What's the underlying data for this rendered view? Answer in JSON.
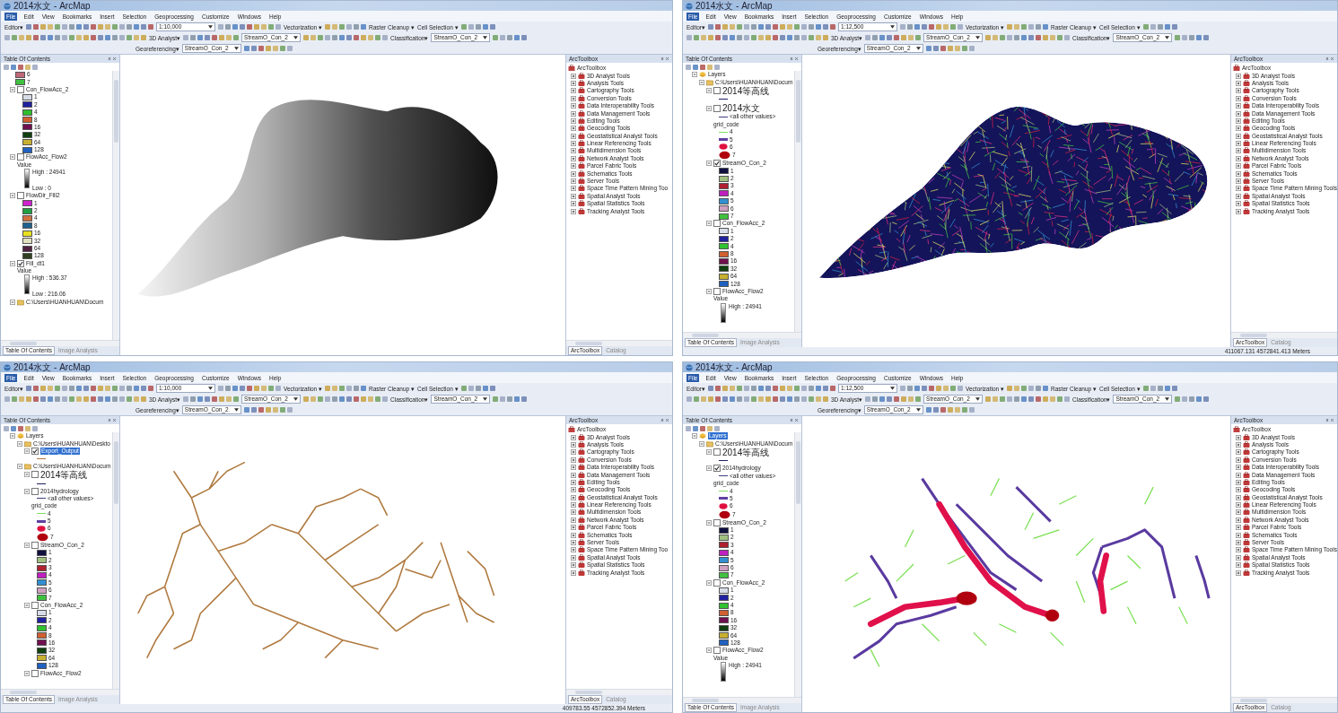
{
  "panels": [
    {
      "title": "2014水文 - ArcMap",
      "menu": [
        {
          "label": "File",
          "selected": true
        },
        {
          "label": "Edit",
          "selected": false
        },
        {
          "label": "View",
          "selected": false
        },
        {
          "label": "Bookmarks",
          "selected": false
        },
        {
          "label": "Insert",
          "selected": false
        },
        {
          "label": "Selection",
          "selected": false
        },
        {
          "label": "Geoprocessing",
          "selected": false
        },
        {
          "label": "Customize",
          "selected": false
        },
        {
          "label": "Windows",
          "selected": false
        },
        {
          "label": "Help",
          "selected": false
        }
      ],
      "toolbars": [
        [
          {
            "kind": "menu",
            "label": "Editor▾"
          },
          {
            "kind": "dropdown",
            "value": "1:10,000"
          },
          {
            "kind": "menu",
            "label": "Vectorization ▾"
          },
          {
            "kind": "menu",
            "label": "Raster Cleanup ▾"
          },
          {
            "kind": "menu",
            "label": "Cell Selection ▾"
          }
        ],
        [
          {
            "kind": "menu",
            "label": "3D Analyst▾"
          },
          {
            "kind": "dropdown",
            "value": "StreamO_Con_2"
          },
          {
            "kind": "menu",
            "label": "Classification▾"
          },
          {
            "kind": "dropdown",
            "value": "StreamO_Con_2"
          }
        ],
        [
          {
            "kind": "menu",
            "label": "Georeferencing▾"
          },
          {
            "kind": "dropdown",
            "value": "StreamO_Con_2"
          }
        ]
      ],
      "toc": {
        "title": "Table Of Contents",
        "items": [
          {
            "kind": "swatch",
            "label": "6",
            "color": "#c06878"
          },
          {
            "kind": "swatch",
            "label": "7",
            "color": "#40c040"
          },
          {
            "kind": "layer",
            "label": "Con_FlowAcc_2",
            "checked": false,
            "selected": false,
            "expanded": true,
            "children": [
              {
                "kind": "swatch",
                "label": "1",
                "color": "#d8dce8"
              },
              {
                "kind": "swatch",
                "label": "2",
                "color": "#2020a0"
              },
              {
                "kind": "swatch",
                "label": "4",
                "color": "#30c030"
              },
              {
                "kind": "swatch",
                "label": "8",
                "color": "#d06030"
              },
              {
                "kind": "swatch",
                "label": "16",
                "color": "#701050"
              },
              {
                "kind": "swatch",
                "label": "32",
                "color": "#104010"
              },
              {
                "kind": "swatch",
                "label": "64",
                "color": "#c8b030"
              },
              {
                "kind": "swatch",
                "label": "128",
                "color": "#2060c0"
              }
            ]
          },
          {
            "kind": "layer",
            "label": "FlowAcc_Flow2",
            "checked": false,
            "selected": false,
            "expanded": true,
            "children": [
              {
                "kind": "heading",
                "label": "Value"
              },
              {
                "kind": "ramp",
                "high": "High : 24941",
                "low": "Low : 0"
              }
            ]
          },
          {
            "kind": "layer",
            "label": "FlowDir_Fill2",
            "checked": false,
            "selected": false,
            "expanded": true,
            "children": [
              {
                "kind": "swatch",
                "label": "1",
                "color": "#d020d0"
              },
              {
                "kind": "swatch",
                "label": "2",
                "color": "#20a040"
              },
              {
                "kind": "swatch",
                "label": "4",
                "color": "#d07040"
              },
              {
                "kind": "swatch",
                "label": "8",
                "color": "#206090"
              },
              {
                "kind": "swatch",
                "label": "16",
                "color": "#e8e020"
              },
              {
                "kind": "swatch",
                "label": "32",
                "color": "#e0e0c0"
              },
              {
                "kind": "swatch",
                "label": "64",
                "color": "#502040"
              },
              {
                "kind": "swatch",
                "label": "128",
                "color": "#304020"
              }
            ]
          },
          {
            "kind": "layer",
            "label": "Fill_dt1",
            "checked": true,
            "selected": false,
            "expanded": true,
            "children": [
              {
                "kind": "heading",
                "label": "Value"
              },
              {
                "kind": "ramp",
                "high": "High : 536.37",
                "low": "Low : 216.06"
              }
            ]
          },
          {
            "kind": "group",
            "label": "C:\\Users\\HUANHUAN\\Docum",
            "selected": false,
            "expanded": true
          }
        ]
      },
      "map": {
        "kind": "elevation"
      },
      "toolbox": {
        "title": "ArcToolbox",
        "root": "ArcToolbox",
        "items": [
          "3D Analyst Tools",
          "Analysis Tools",
          "Cartography Tools",
          "Conversion Tools",
          "Data Interoperability Tools",
          "Data Management Tools",
          "Editing Tools",
          "Geocoding Tools",
          "Geostatistical Analyst Tools",
          "Linear Referencing Tools",
          "Multidimension Tools",
          "Network Analyst Tools",
          "Parcel Fabric Tools",
          "Schematics Tools",
          "Server Tools",
          "Space Time Pattern Mining Too",
          "Spatial Analyst Tools",
          "Spatial Statistics Tools",
          "Tracking Analyst Tools"
        ]
      },
      "tabs_left": [
        {
          "label": "Table Of Contents",
          "selected": true
        },
        {
          "label": "Image Analysis",
          "selected": false
        }
      ],
      "tabs_right": [
        {
          "label": "ArcToolbox",
          "selected": true
        },
        {
          "label": "Catalog",
          "selected": false
        }
      ]
    },
    {
      "title": "2014水文 - ArcMap",
      "menu": [
        {
          "label": "File",
          "selected": true
        },
        {
          "label": "Edit",
          "selected": false
        },
        {
          "label": "View",
          "selected": false
        },
        {
          "label": "Bookmarks",
          "selected": false
        },
        {
          "label": "Insert",
          "selected": false
        },
        {
          "label": "Selection",
          "selected": false
        },
        {
          "label": "Geoprocessing",
          "selected": false
        },
        {
          "label": "Customize",
          "selected": false
        },
        {
          "label": "Windows",
          "selected": false
        },
        {
          "label": "Help",
          "selected": false
        }
      ],
      "toolbars": [
        [
          {
            "kind": "menu",
            "label": "Editor▾"
          },
          {
            "kind": "dropdown",
            "value": "1:12,500"
          },
          {
            "kind": "menu",
            "label": "Vectorization ▾"
          },
          {
            "kind": "menu",
            "label": "Raster Cleanup ▾"
          },
          {
            "kind": "menu",
            "label": "Cell Selection ▾"
          }
        ],
        [
          {
            "kind": "menu",
            "label": "3D Analyst▾"
          },
          {
            "kind": "dropdown",
            "value": "StreamO_Con_2"
          },
          {
            "kind": "menu",
            "label": "Classification▾"
          },
          {
            "kind": "dropdown",
            "value": "StreamO_Con_2"
          }
        ],
        [
          {
            "kind": "menu",
            "label": "Georeferencing▾"
          },
          {
            "kind": "dropdown",
            "value": "StreamO_Con_2"
          }
        ]
      ],
      "toc": {
        "title": "Table Of Contents",
        "items": [
          {
            "kind": "root",
            "label": "Layers",
            "selected": false,
            "expanded": true,
            "children": [
              {
                "kind": "group",
                "label": "C:\\Users\\HUANHUAN\\Docum",
                "selected": false,
                "expanded": true,
                "children": [
                  {
                    "kind": "layer",
                    "label": "2014等高线",
                    "checked": false,
                    "selected": false,
                    "expanded": true,
                    "children": [
                      {
                        "kind": "dash",
                        "color": "#202060"
                      }
                    ]
                  },
                  {
                    "kind": "layer",
                    "label": "2014水文",
                    "checked": false,
                    "selected": false,
                    "expanded": true,
                    "children": [
                      {
                        "kind": "line",
                        "label": "<all other values>",
                        "color": "#404080"
                      },
                      {
                        "kind": "heading",
                        "label": "grid_code"
                      },
                      {
                        "kind": "line",
                        "label": "4",
                        "color": "#80e060"
                      },
                      {
                        "kind": "thick-line",
                        "label": "5",
                        "color": "#6040a0"
                      },
                      {
                        "kind": "blob",
                        "label": "6",
                        "color": "#e01040"
                      },
                      {
                        "kind": "big-blob",
                        "label": "7",
                        "color": "#b00010"
                      }
                    ]
                  },
                  {
                    "kind": "layer",
                    "label": "StreamO_Con_2",
                    "checked": true,
                    "selected": false,
                    "expanded": true,
                    "children": [
                      {
                        "kind": "swatch",
                        "label": "1",
                        "color": "#101040"
                      },
                      {
                        "kind": "swatch",
                        "label": "2",
                        "color": "#a0c080"
                      },
                      {
                        "kind": "swatch",
                        "label": "3",
                        "color": "#b02030"
                      },
                      {
                        "kind": "swatch",
                        "label": "4",
                        "color": "#c020c0"
                      },
                      {
                        "kind": "swatch",
                        "label": "5",
                        "color": "#3090d0"
                      },
                      {
                        "kind": "swatch",
                        "label": "6",
                        "color": "#d0a0c0"
                      },
                      {
                        "kind": "swatch",
                        "label": "7",
                        "color": "#40c040"
                      }
                    ]
                  },
                  {
                    "kind": "layer",
                    "label": "Con_FlowAcc_2",
                    "checked": false,
                    "selected": false,
                    "expanded": true,
                    "children": [
                      {
                        "kind": "swatch",
                        "label": "1",
                        "color": "#d8dce8"
                      },
                      {
                        "kind": "swatch",
                        "label": "2",
                        "color": "#2020a0"
                      },
                      {
                        "kind": "swatch",
                        "label": "4",
                        "color": "#30c030"
                      },
                      {
                        "kind": "swatch",
                        "label": "8",
                        "color": "#d06030"
                      },
                      {
                        "kind": "swatch",
                        "label": "16",
                        "color": "#701050"
                      },
                      {
                        "kind": "swatch",
                        "label": "32",
                        "color": "#104010"
                      },
                      {
                        "kind": "swatch",
                        "label": "64",
                        "color": "#c8b030"
                      },
                      {
                        "kind": "swatch",
                        "label": "128",
                        "color": "#2060c0"
                      }
                    ]
                  },
                  {
                    "kind": "layer",
                    "label": "FlowAcc_Flow2",
                    "checked": false,
                    "selected": false,
                    "expanded": true,
                    "children": [
                      {
                        "kind": "heading",
                        "label": "Value"
                      },
                      {
                        "kind": "ramp",
                        "high": "High : 24941"
                      }
                    ]
                  }
                ]
              }
            ]
          }
        ]
      },
      "map": {
        "kind": "stream-order-raster"
      },
      "toolbox": {
        "title": "ArcToolbox",
        "root": "ArcToolbox",
        "items": [
          "3D Analyst Tools",
          "Analysis Tools",
          "Cartography Tools",
          "Conversion Tools",
          "Data Interoperability Tools",
          "Data Management Tools",
          "Editing Tools",
          "Geocoding Tools",
          "Geostatistical Analyst Tools",
          "Linear Referencing Tools",
          "Multidimension Tools",
          "Network Analyst Tools",
          "Parcel Fabric Tools",
          "Schematics Tools",
          "Server Tools",
          "Space Time Pattern Mining Tools",
          "Spatial Analyst Tools",
          "Spatial Statistics Tools",
          "Tracking Analyst Tools"
        ]
      },
      "tabs_left": [
        {
          "label": "Table Of Contents",
          "selected": true
        },
        {
          "label": "Image Analysis",
          "selected": false
        }
      ],
      "tabs_right": [
        {
          "label": "ArcToolbox",
          "selected": true
        },
        {
          "label": "Catalog",
          "selected": false
        }
      ],
      "status": "411067.131  4572841.413 Meters"
    },
    {
      "title": "2014水文 - ArcMap",
      "menu": [
        {
          "label": "File",
          "selected": true
        },
        {
          "label": "Edit",
          "selected": false
        },
        {
          "label": "View",
          "selected": false
        },
        {
          "label": "Bookmarks",
          "selected": false
        },
        {
          "label": "Insert",
          "selected": false
        },
        {
          "label": "Selection",
          "selected": false
        },
        {
          "label": "Geoprocessing",
          "selected": false
        },
        {
          "label": "Customize",
          "selected": false
        },
        {
          "label": "Windows",
          "selected": false
        },
        {
          "label": "Help",
          "selected": false
        }
      ],
      "toolbars": [
        [
          {
            "kind": "menu",
            "label": "Editor▾"
          },
          {
            "kind": "dropdown",
            "value": "1:10,000"
          },
          {
            "kind": "menu",
            "label": "Vectorization ▾"
          },
          {
            "kind": "menu",
            "label": "Raster Cleanup ▾"
          },
          {
            "kind": "menu",
            "label": "Cell Selection ▾"
          }
        ],
        [
          {
            "kind": "menu",
            "label": "3D Analyst▾"
          },
          {
            "kind": "dropdown",
            "value": "StreamO_Con_2"
          },
          {
            "kind": "menu",
            "label": "Classification▾"
          },
          {
            "kind": "dropdown",
            "value": "StreamO_Con_2"
          }
        ],
        [
          {
            "kind": "menu",
            "label": "Georeferencing▾"
          },
          {
            "kind": "dropdown",
            "value": "StreamO_Con_2"
          }
        ]
      ],
      "toc": {
        "title": "Table Of Contents",
        "items": [
          {
            "kind": "root",
            "label": "Layers",
            "selected": false,
            "expanded": true,
            "children": [
              {
                "kind": "group",
                "label": "C:\\Users\\HUANHUAN\\Deskto",
                "selected": false,
                "expanded": true,
                "children": [
                  {
                    "kind": "layer",
                    "label": "Export_Output",
                    "checked": true,
                    "selected": true,
                    "expanded": true,
                    "children": [
                      {
                        "kind": "dash",
                        "color": "#b07a40"
                      }
                    ]
                  }
                ]
              },
              {
                "kind": "group",
                "label": "C:\\Users\\HUANHUAN\\Docum",
                "selected": false,
                "expanded": true,
                "children": [
                  {
                    "kind": "layer",
                    "label": "2014等高线",
                    "checked": false,
                    "selected": false,
                    "expanded": true,
                    "children": [
                      {
                        "kind": "dash",
                        "color": "#202060"
                      }
                    ]
                  },
                  {
                    "kind": "layer",
                    "label": "2014hydrology",
                    "checked": false,
                    "selected": false,
                    "expanded": true,
                    "children": [
                      {
                        "kind": "line",
                        "label": "<all other values>",
                        "color": "#404080"
                      },
                      {
                        "kind": "heading",
                        "label": "grid_code"
                      },
                      {
                        "kind": "line",
                        "label": "4",
                        "color": "#80e060"
                      },
                      {
                        "kind": "thick-line",
                        "label": "5",
                        "color": "#6040a0"
                      },
                      {
                        "kind": "blob",
                        "label": "6",
                        "color": "#e01040"
                      },
                      {
                        "kind": "big-blob",
                        "label": "7",
                        "color": "#b00010"
                      }
                    ]
                  },
                  {
                    "kind": "layer",
                    "label": "StreamO_Con_2",
                    "checked": false,
                    "selected": false,
                    "expanded": true,
                    "children": [
                      {
                        "kind": "swatch",
                        "label": "1",
                        "color": "#101040"
                      },
                      {
                        "kind": "swatch",
                        "label": "2",
                        "color": "#a0c080"
                      },
                      {
                        "kind": "swatch",
                        "label": "3",
                        "color": "#b02030"
                      },
                      {
                        "kind": "swatch",
                        "label": "4",
                        "color": "#c020c0"
                      },
                      {
                        "kind": "swatch",
                        "label": "5",
                        "color": "#3090d0"
                      },
                      {
                        "kind": "swatch",
                        "label": "6",
                        "color": "#d0a0c0"
                      },
                      {
                        "kind": "swatch",
                        "label": "7",
                        "color": "#40c040"
                      }
                    ]
                  },
                  {
                    "kind": "layer",
                    "label": "Con_FlowAcc_2",
                    "checked": false,
                    "selected": false,
                    "expanded": true,
                    "children": [
                      {
                        "kind": "swatch",
                        "label": "1",
                        "color": "#d8dce8"
                      },
                      {
                        "kind": "swatch",
                        "label": "2",
                        "color": "#2020a0"
                      },
                      {
                        "kind": "swatch",
                        "label": "4",
                        "color": "#30c030"
                      },
                      {
                        "kind": "swatch",
                        "label": "8",
                        "color": "#d06030"
                      },
                      {
                        "kind": "swatch",
                        "label": "16",
                        "color": "#701050"
                      },
                      {
                        "kind": "swatch",
                        "label": "32",
                        "color": "#104010"
                      },
                      {
                        "kind": "swatch",
                        "label": "64",
                        "color": "#c8b030"
                      },
                      {
                        "kind": "swatch",
                        "label": "128",
                        "color": "#2060c0"
                      }
                    ]
                  },
                  {
                    "kind": "layer",
                    "label": "FlowAcc_Flow2",
                    "checked": false,
                    "selected": false,
                    "expanded": true
                  }
                ]
              }
            ]
          }
        ]
      },
      "map": {
        "kind": "stream-lines"
      },
      "toolbox": {
        "title": "ArcToolbox",
        "root": "ArcToolbox",
        "items": [
          "3D Analyst Tools",
          "Analysis Tools",
          "Cartography Tools",
          "Conversion Tools",
          "Data Interoperability Tools",
          "Data Management Tools",
          "Editing Tools",
          "Geocoding Tools",
          "Geostatistical Analyst Tools",
          "Linear Referencing Tools",
          "Multidimension Tools",
          "Network Analyst Tools",
          "Parcel Fabric Tools",
          "Schematics Tools",
          "Server Tools",
          "Space Time Pattern Mining Too",
          "Spatial Analyst Tools",
          "Spatial Statistics Tools",
          "Tracking Analyst Tools"
        ]
      },
      "tabs_left": [
        {
          "label": "Table Of Contents",
          "selected": true
        },
        {
          "label": "Image Analysis",
          "selected": false
        }
      ],
      "tabs_right": [
        {
          "label": "ArcToolbox",
          "selected": true
        },
        {
          "label": "Catalog",
          "selected": false
        }
      ],
      "status": "409783.55  4572852.394 Meters"
    },
    {
      "title": "2014水文 - ArcMap",
      "menu": [
        {
          "label": "File",
          "selected": true
        },
        {
          "label": "Edit",
          "selected": false
        },
        {
          "label": "View",
          "selected": false
        },
        {
          "label": "Bookmarks",
          "selected": false
        },
        {
          "label": "Insert",
          "selected": false
        },
        {
          "label": "Selection",
          "selected": false
        },
        {
          "label": "Geoprocessing",
          "selected": false
        },
        {
          "label": "Customize",
          "selected": false
        },
        {
          "label": "Windows",
          "selected": false
        },
        {
          "label": "Help",
          "selected": false
        }
      ],
      "toolbars": [
        [
          {
            "kind": "menu",
            "label": "Editor▾"
          },
          {
            "kind": "dropdown",
            "value": "1:12,500"
          },
          {
            "kind": "menu",
            "label": "Vectorization ▾"
          },
          {
            "kind": "menu",
            "label": "Raster Cleanup ▾"
          },
          {
            "kind": "menu",
            "label": "Cell Selection ▾"
          }
        ],
        [
          {
            "kind": "menu",
            "label": "3D Analyst▾"
          },
          {
            "kind": "dropdown",
            "value": "StreamO_Con_2"
          },
          {
            "kind": "menu",
            "label": "Classification▾"
          },
          {
            "kind": "dropdown",
            "value": "StreamO_Con_2"
          }
        ],
        [
          {
            "kind": "menu",
            "label": "Georeferencing▾"
          },
          {
            "kind": "dropdown",
            "value": "StreamO_Con_2"
          }
        ]
      ],
      "toc": {
        "title": "Table Of Contents",
        "items": [
          {
            "kind": "root",
            "label": "Layers",
            "selected": true,
            "expanded": true,
            "children": [
              {
                "kind": "group",
                "label": "C:\\Users\\HUANHUAN\\Docum",
                "selected": false,
                "expanded": true,
                "children": [
                  {
                    "kind": "layer",
                    "label": "2014等高线",
                    "checked": false,
                    "selected": false,
                    "expanded": true,
                    "children": [
                      {
                        "kind": "dash",
                        "color": "#202060"
                      }
                    ]
                  },
                  {
                    "kind": "layer",
                    "label": "2014hydrology",
                    "checked": true,
                    "selected": false,
                    "expanded": true,
                    "children": [
                      {
                        "kind": "line",
                        "label": "<all other values>",
                        "color": "#404080"
                      },
                      {
                        "kind": "heading",
                        "label": "grid_code"
                      },
                      {
                        "kind": "line",
                        "label": "4",
                        "color": "#80e060"
                      },
                      {
                        "kind": "thick-line",
                        "label": "5",
                        "color": "#6040a0"
                      },
                      {
                        "kind": "blob",
                        "label": "6",
                        "color": "#e01040"
                      },
                      {
                        "kind": "big-blob",
                        "label": "7",
                        "color": "#b00010"
                      }
                    ]
                  },
                  {
                    "kind": "layer",
                    "label": "StreamO_Con_2",
                    "checked": false,
                    "selected": false,
                    "expanded": true,
                    "children": [
                      {
                        "kind": "swatch",
                        "label": "1",
                        "color": "#101040"
                      },
                      {
                        "kind": "swatch",
                        "label": "2",
                        "color": "#a0c080"
                      },
                      {
                        "kind": "swatch",
                        "label": "3",
                        "color": "#b02030"
                      },
                      {
                        "kind": "swatch",
                        "label": "4",
                        "color": "#c020c0"
                      },
                      {
                        "kind": "swatch",
                        "label": "5",
                        "color": "#3090d0"
                      },
                      {
                        "kind": "swatch",
                        "label": "6",
                        "color": "#d0a0c0"
                      },
                      {
                        "kind": "swatch",
                        "label": "7",
                        "color": "#40c040"
                      }
                    ]
                  },
                  {
                    "kind": "layer",
                    "label": "Con_FlowAcc_2",
                    "checked": false,
                    "selected": false,
                    "expanded": true,
                    "children": [
                      {
                        "kind": "swatch",
                        "label": "1",
                        "color": "#d8dce8"
                      },
                      {
                        "kind": "swatch",
                        "label": "2",
                        "color": "#2020a0"
                      },
                      {
                        "kind": "swatch",
                        "label": "4",
                        "color": "#30c030"
                      },
                      {
                        "kind": "swatch",
                        "label": "8",
                        "color": "#d06030"
                      },
                      {
                        "kind": "swatch",
                        "label": "16",
                        "color": "#701050"
                      },
                      {
                        "kind": "swatch",
                        "label": "32",
                        "color": "#104010"
                      },
                      {
                        "kind": "swatch",
                        "label": "64",
                        "color": "#c8b030"
                      },
                      {
                        "kind": "swatch",
                        "label": "128",
                        "color": "#2060c0"
                      }
                    ]
                  },
                  {
                    "kind": "layer",
                    "label": "FlowAcc_Flow2",
                    "checked": false,
                    "selected": false,
                    "expanded": true,
                    "children": [
                      {
                        "kind": "heading",
                        "label": "Value"
                      },
                      {
                        "kind": "ramp",
                        "high": "High : 24941"
                      }
                    ]
                  }
                ]
              }
            ]
          }
        ]
      },
      "map": {
        "kind": "graded-streams"
      },
      "toolbox": {
        "title": "ArcToolbox",
        "root": "ArcToolbox",
        "items": [
          "3D Analyst Tools",
          "Analysis Tools",
          "Cartography Tools",
          "Conversion Tools",
          "Data Interoperability Tools",
          "Data Management Tools",
          "Editing Tools",
          "Geocoding Tools",
          "Geostatistical Analyst Tools",
          "Linear Referencing Tools",
          "Multidimension Tools",
          "Network Analyst Tools",
          "Parcel Fabric Tools",
          "Schematics Tools",
          "Server Tools",
          "Space Time Pattern Mining Tools",
          "Spatial Analyst Tools",
          "Spatial Statistics Tools",
          "Tracking Analyst Tools"
        ]
      },
      "tabs_left": [
        {
          "label": "Table Of Contents",
          "selected": true
        },
        {
          "label": "Image Analysis",
          "selected": false
        }
      ],
      "tabs_right": [
        {
          "label": "ArcToolbox",
          "selected": true
        },
        {
          "label": "Catalog",
          "selected": false
        }
      ]
    }
  ]
}
